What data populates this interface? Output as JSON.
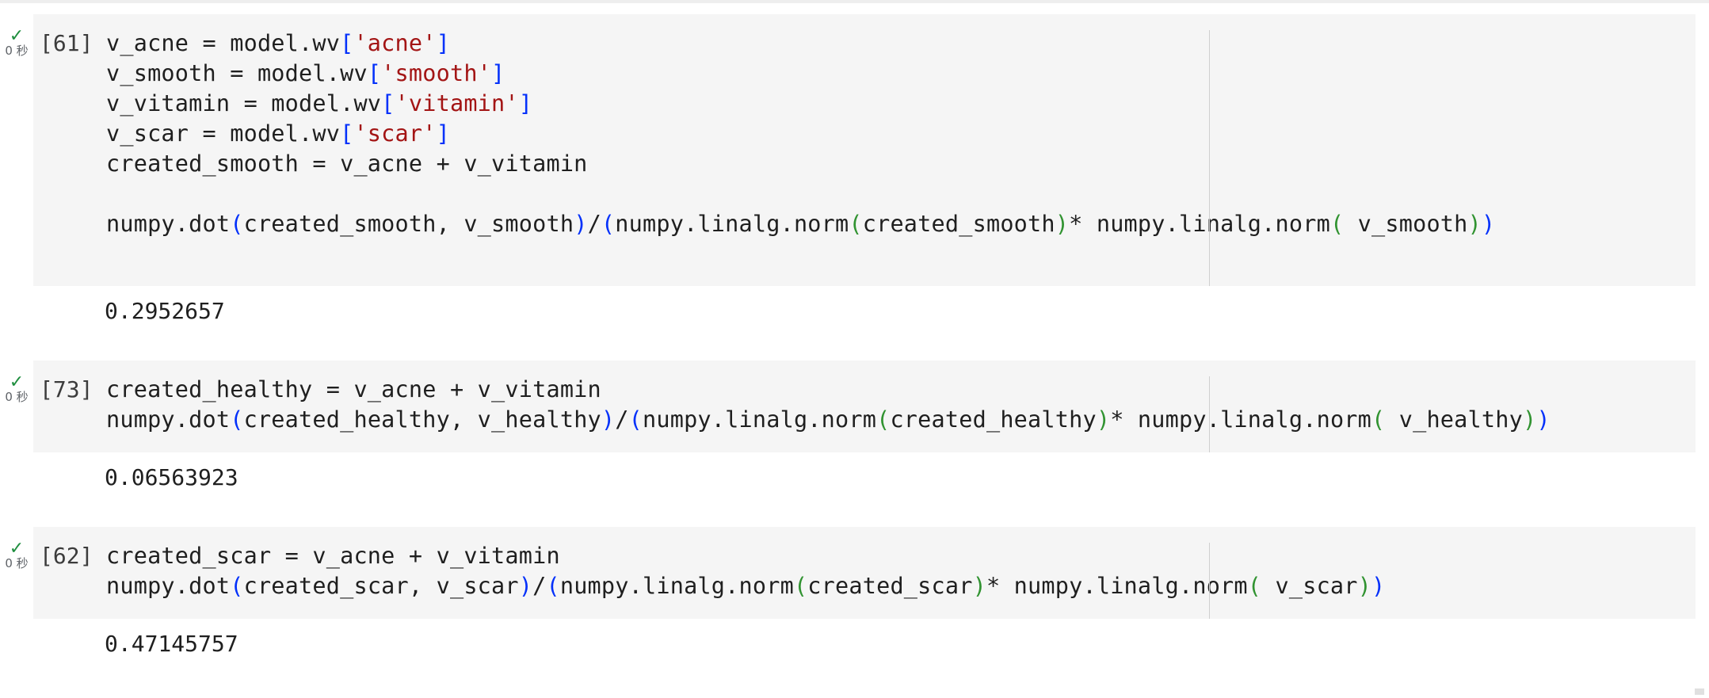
{
  "cells": [
    {
      "exec_count": "[61]",
      "status_icon": "check-icon",
      "exec_time": "0 秒",
      "code_lines": [
        [
          {
            "t": "v_acne = model.wv"
          },
          {
            "t": "[",
            "c": "b1"
          },
          {
            "t": "'acne'",
            "c": "str"
          },
          {
            "t": "]",
            "c": "b1"
          }
        ],
        [
          {
            "t": "v_smooth = model.wv"
          },
          {
            "t": "[",
            "c": "b1"
          },
          {
            "t": "'smooth'",
            "c": "str"
          },
          {
            "t": "]",
            "c": "b1"
          }
        ],
        [
          {
            "t": "v_vitamin = model.wv"
          },
          {
            "t": "[",
            "c": "b1"
          },
          {
            "t": "'vitamin'",
            "c": "str"
          },
          {
            "t": "]",
            "c": "b1"
          }
        ],
        [
          {
            "t": "v_scar = model.wv"
          },
          {
            "t": "[",
            "c": "b1"
          },
          {
            "t": "'scar'",
            "c": "str"
          },
          {
            "t": "]",
            "c": "b1"
          }
        ],
        [
          {
            "t": "created_smooth = v_acne + v_vitamin"
          }
        ],
        [
          {
            "t": ""
          }
        ],
        [
          {
            "t": "numpy.dot"
          },
          {
            "t": "(",
            "c": "b1"
          },
          {
            "t": "created_smooth, v_smooth"
          },
          {
            "t": ")",
            "c": "b1"
          },
          {
            "t": "/"
          },
          {
            "t": "(",
            "c": "b1"
          },
          {
            "t": "numpy.linalg.norm"
          },
          {
            "t": "(",
            "c": "b2"
          },
          {
            "t": "created_smooth"
          },
          {
            "t": ")",
            "c": "b2"
          },
          {
            "t": "* numpy.linalg.norm"
          },
          {
            "t": "(",
            "c": "b2"
          },
          {
            "t": " v_smooth"
          },
          {
            "t": ")",
            "c": "b2"
          },
          {
            "t": ")",
            "c": "b1"
          }
        ]
      ],
      "output": "0.2952657"
    },
    {
      "exec_count": "[73]",
      "status_icon": "check-icon",
      "exec_time": "0 秒",
      "code_lines": [
        [
          {
            "t": "created_healthy = v_acne + v_vitamin"
          }
        ],
        [
          {
            "t": "numpy.dot"
          },
          {
            "t": "(",
            "c": "b1"
          },
          {
            "t": "created_healthy, v_healthy"
          },
          {
            "t": ")",
            "c": "b1"
          },
          {
            "t": "/"
          },
          {
            "t": "(",
            "c": "b1"
          },
          {
            "t": "numpy.linalg.norm"
          },
          {
            "t": "(",
            "c": "b2"
          },
          {
            "t": "created_healthy"
          },
          {
            "t": ")",
            "c": "b2"
          },
          {
            "t": "* numpy.linalg.norm"
          },
          {
            "t": "(",
            "c": "b2"
          },
          {
            "t": " v_healthy"
          },
          {
            "t": ")",
            "c": "b2"
          },
          {
            "t": ")",
            "c": "b1"
          }
        ]
      ],
      "output": "0.06563923"
    },
    {
      "exec_count": "[62]",
      "status_icon": "check-icon",
      "exec_time": "0 秒",
      "code_lines": [
        [
          {
            "t": "created_scar = v_acne + v_vitamin"
          }
        ],
        [
          {
            "t": "numpy.dot"
          },
          {
            "t": "(",
            "c": "b1"
          },
          {
            "t": "created_scar, v_scar"
          },
          {
            "t": ")",
            "c": "b1"
          },
          {
            "t": "/"
          },
          {
            "t": "(",
            "c": "b1"
          },
          {
            "t": "numpy.linalg.norm"
          },
          {
            "t": "(",
            "c": "b2"
          },
          {
            "t": "created_scar"
          },
          {
            "t": ")",
            "c": "b2"
          },
          {
            "t": "* numpy.linalg.norm"
          },
          {
            "t": "(",
            "c": "b2"
          },
          {
            "t": " v_scar"
          },
          {
            "t": ")",
            "c": "b2"
          },
          {
            "t": ")",
            "c": "b1"
          }
        ]
      ],
      "output": "0.47145757"
    }
  ],
  "colors": {
    "string": "#a31515",
    "bracket_outer": "#0431fa",
    "bracket_inner": "#319331",
    "success": "#1e8e3e",
    "cell_bg": "#f5f5f5"
  }
}
